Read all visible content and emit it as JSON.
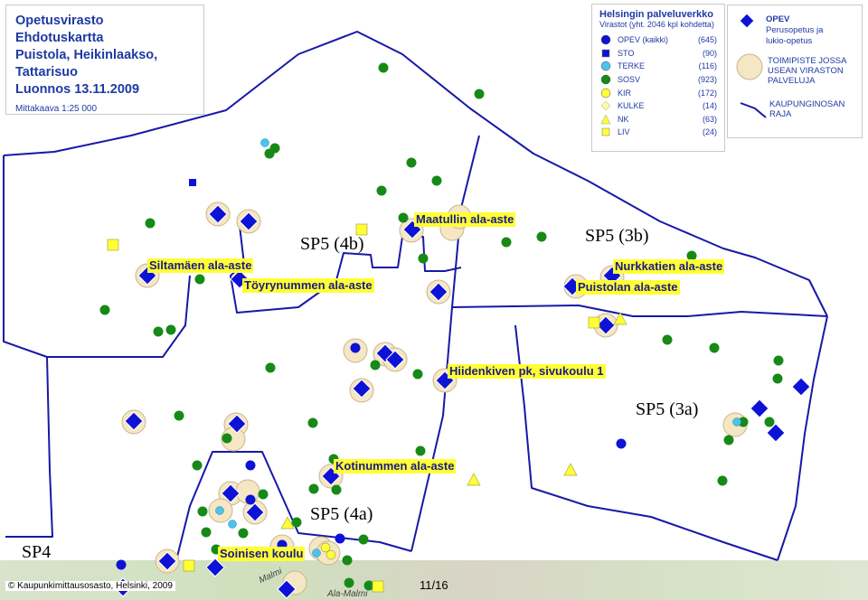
{
  "title": {
    "lines": [
      "Opetusvirasto",
      "Ehdotuskartta",
      "Puistola, Heikinlaakso,",
      "Tattarisuo",
      "Luonnos 13.11.2009"
    ],
    "scale": "Mittakaava 1:25 000"
  },
  "legend": {
    "heading": "Helsingin palveluverkko",
    "subheading": "Virastot (yht. 2046 kpl kohdetta)",
    "items": [
      {
        "name": "OPEV (kaikki)",
        "count": "(645)",
        "color": "#0d12d6",
        "shape": "circle"
      },
      {
        "name": "STO",
        "count": "(90)",
        "color": "#0d12d6",
        "shape": "square"
      },
      {
        "name": "TERKE",
        "count": "(116)",
        "color": "#4cc3ea",
        "shape": "circle"
      },
      {
        "name": "SOSV",
        "count": "(923)",
        "color": "#168a16",
        "shape": "circle"
      },
      {
        "name": "KIR",
        "count": "(172)",
        "color": "#ffff33",
        "shape": "circle"
      },
      {
        "name": "KULKE",
        "count": "(14)",
        "color": "#ffff99",
        "shape": "diamond"
      },
      {
        "name": "NK",
        "count": "(63)",
        "color": "#ffff33",
        "shape": "triangle"
      },
      {
        "name": "LIV",
        "count": "(24)",
        "color": "#ffff33",
        "shape": "square"
      }
    ]
  },
  "legend2": {
    "opev_title": "OPEV",
    "opev_desc": [
      "Perusopetus ja",
      "lukio-opetus"
    ],
    "multi_desc": [
      "TOIMIPISTE JOSSA",
      "USEAN VIRASTON",
      "PALVELUJA"
    ],
    "boundary_desc": [
      "KAUPUNGINOSAN",
      "RAJA"
    ]
  },
  "areas": [
    "SP5 (4b)",
    "SP5 (3b)",
    "SP5 (3a)",
    "SP5 (4a)",
    "SP4"
  ],
  "schools": [
    "Maatullin ala-aste",
    "Siltamäen ala-aste",
    "Töyrynummen ala-aste",
    "Nurkkatien ala-aste",
    "Puistolan ala-aste",
    "Hiidenkiven pk, sivukoulu 1",
    "Kotinummen ala-aste",
    "Soinisen koulu"
  ],
  "streets": [
    "Malmi",
    "Ala-Malmi"
  ],
  "credit": "© Kaupunkimittausosasto, Helsinki, 2009",
  "page": "11/16",
  "colors": {
    "boundary": "#1818a8",
    "opev": "#0d12d6",
    "sosv": "#168a16",
    "halo": "#f5e6c4",
    "label_bg": "#ffff33"
  }
}
